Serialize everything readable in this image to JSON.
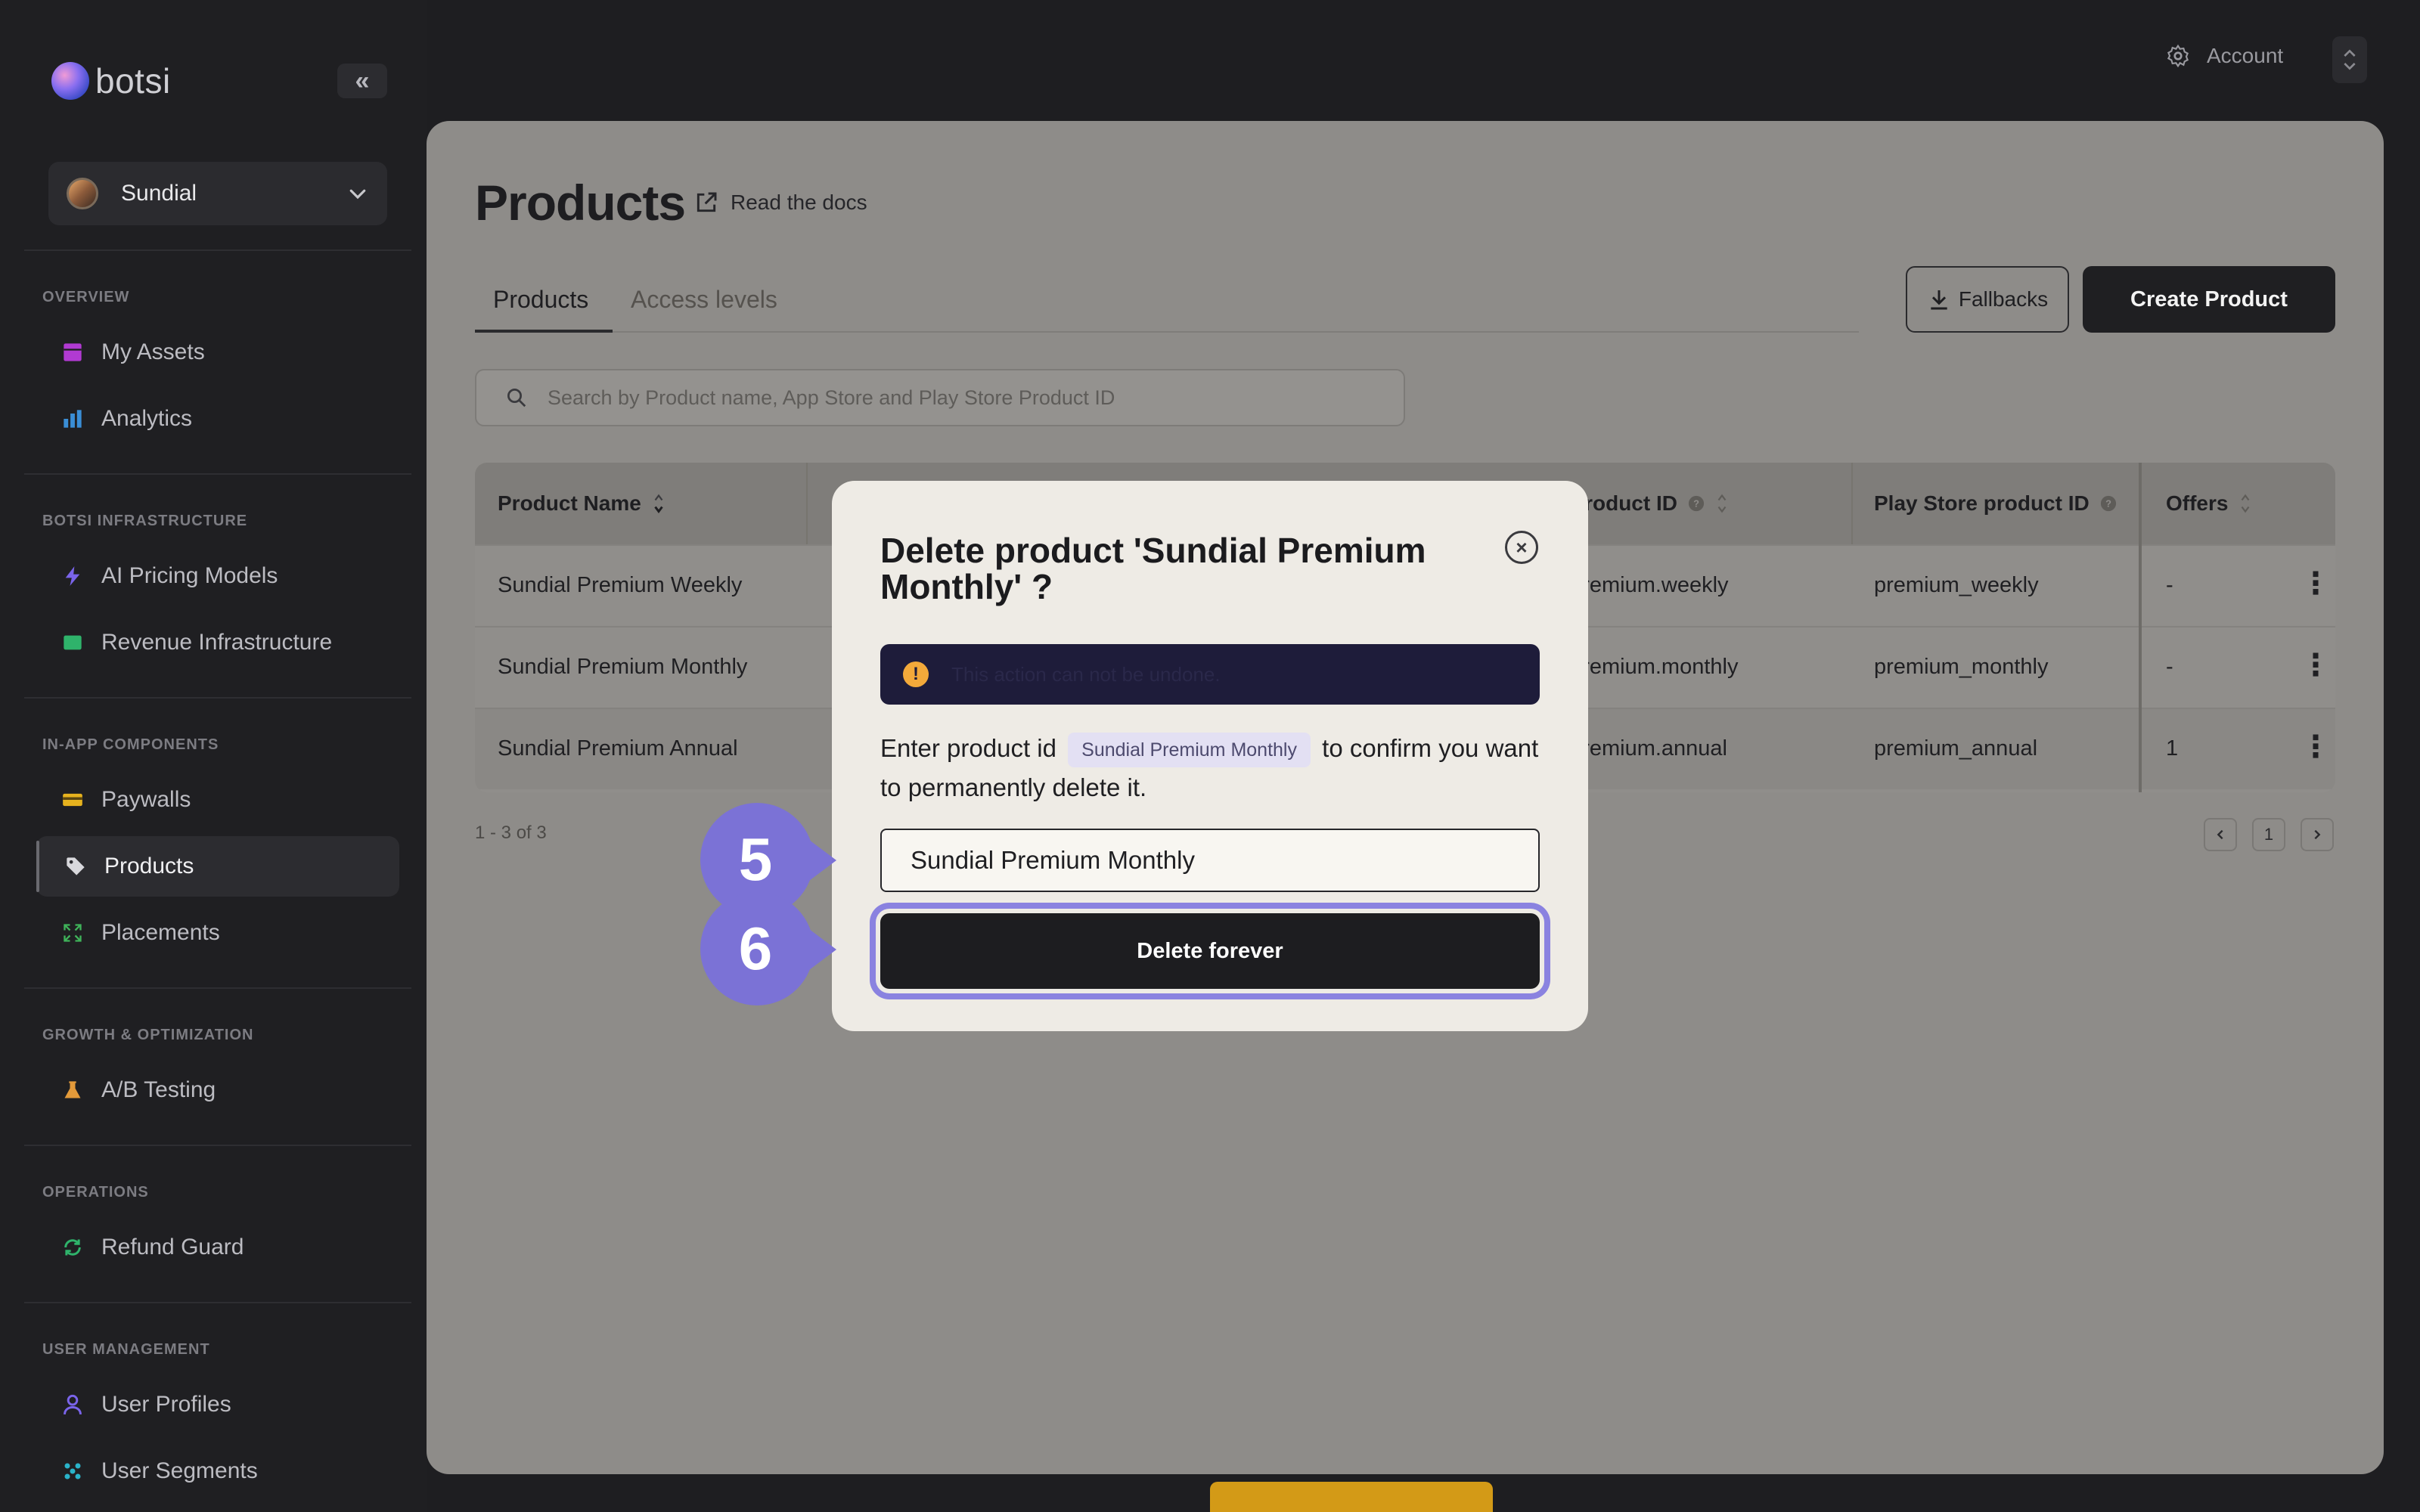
{
  "app": {
    "name": "botsi",
    "collapse_icon": "«",
    "project": "Sundial",
    "account_label": "Account"
  },
  "sidebar": {
    "sections": [
      {
        "label": "OVERVIEW",
        "items": [
          {
            "label": "My Assets",
            "icon": "grid-icon",
            "color": "#b13ad2"
          },
          {
            "label": "Analytics",
            "icon": "bar-chart-icon",
            "color": "#3a8ed6"
          }
        ]
      },
      {
        "label": "BOTSI INFRASTRUCTURE",
        "items": [
          {
            "label": "AI Pricing Models",
            "icon": "bolt-icon",
            "color": "#7a64ea"
          },
          {
            "label": "Revenue Infrastructure",
            "icon": "card-icon",
            "color": "#2fb36b"
          }
        ]
      },
      {
        "label": "IN-APP COMPONENTS",
        "items": [
          {
            "label": "Paywalls",
            "icon": "wallet-icon",
            "color": "#e6b21e"
          },
          {
            "label": "Products",
            "icon": "tag-icon",
            "color": "#d8d8dc",
            "active": true
          },
          {
            "label": "Placements",
            "icon": "expand-icon",
            "color": "#3fb35a"
          }
        ]
      },
      {
        "label": "GROWTH & OPTIMIZATION",
        "items": [
          {
            "label": "A/B Testing",
            "icon": "flask-icon",
            "color": "#e39a3a"
          }
        ]
      },
      {
        "label": "OPERATIONS",
        "items": [
          {
            "label": "Refund Guard",
            "icon": "refresh-icon",
            "color": "#2fb36b"
          }
        ]
      },
      {
        "label": "USER MANAGEMENT",
        "items": [
          {
            "label": "User Profiles",
            "icon": "user-icon",
            "color": "#7a64ea"
          },
          {
            "label": "User Segments",
            "icon": "segments-icon",
            "color": "#2ab3c9"
          }
        ]
      }
    ]
  },
  "main": {
    "title": "Products",
    "docs_link": "Read the docs",
    "tabs": [
      {
        "label": "Products",
        "active": true
      },
      {
        "label": "Access levels",
        "active": false
      }
    ],
    "fallbacks_label": "Fallbacks",
    "create_label": "Create Product",
    "search_placeholder": "Search by Product name, App Store and Play Store Product ID",
    "table": {
      "headers": [
        "Product Name",
        "product ID",
        "Play Store product ID",
        "Offers"
      ],
      "rows": [
        {
          "name": "Sundial Premium Weekly",
          "app_store_id": ".premium.weekly",
          "play_store_id": "premium_weekly",
          "offers": "-"
        },
        {
          "name": "Sundial Premium Monthly",
          "app_store_id": ".premium.monthly",
          "play_store_id": "premium_monthly",
          "offers": "-"
        },
        {
          "name": "Sundial Premium Annual",
          "app_store_id": ".premium.annual",
          "play_store_id": "premium_annual",
          "offers": "1"
        }
      ]
    },
    "pagination": {
      "info": "1 - 3 of 3",
      "page": "1"
    }
  },
  "modal": {
    "title": "Delete product 'Sundial Premium Monthly' ?",
    "warning": "This action can not be undone.",
    "confirm_prefix": "Enter product id",
    "confirm_chip": "Sundial Premium Monthly",
    "confirm_suffix": "to confirm you want to permanently delete it.",
    "input_value": "Sundial Premium Monthly",
    "delete_label": "Delete forever"
  },
  "steps": {
    "input_step": "5",
    "delete_step": "6"
  },
  "colors": {
    "accent": "#7b72d6",
    "warning": "#f3a93a",
    "overlay_bar": "#d39a17"
  }
}
